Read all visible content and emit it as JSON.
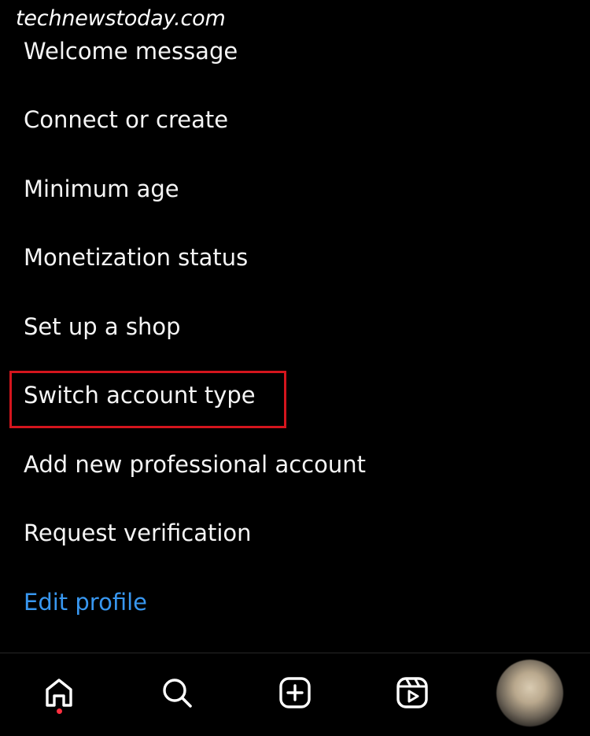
{
  "watermark": "technewstoday.com",
  "menu": {
    "items": [
      {
        "label": "Welcome message"
      },
      {
        "label": "Connect or create"
      },
      {
        "label": "Minimum age"
      },
      {
        "label": "Monetization status"
      },
      {
        "label": "Set up a shop"
      },
      {
        "label": "Switch account type",
        "highlighted": true
      },
      {
        "label": "Add new professional account"
      },
      {
        "label": "Request verification"
      }
    ],
    "edit_profile": "Edit profile"
  },
  "bottom_nav": {
    "tabs": [
      {
        "icon": "home-icon",
        "active": true,
        "notification_dot": true
      },
      {
        "icon": "search-icon"
      },
      {
        "icon": "create-icon"
      },
      {
        "icon": "reels-icon"
      },
      {
        "icon": "profile-avatar"
      }
    ]
  },
  "colors": {
    "background": "#000000",
    "text": "#f5f5f5",
    "link": "#3897f0",
    "highlight_border": "#d4151d",
    "notification_dot": "#ff3040"
  }
}
